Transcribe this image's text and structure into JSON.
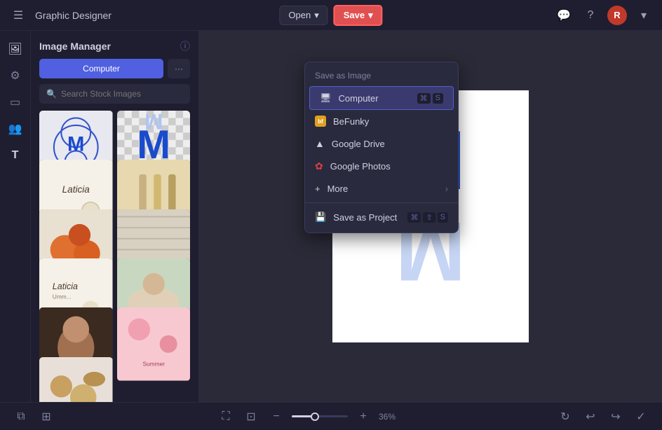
{
  "app": {
    "title": "Graphic Designer",
    "menu_icon": "☰"
  },
  "header": {
    "open_label": "Open",
    "open_chevron": "▾",
    "save_label": "Save",
    "save_chevron": "▾",
    "chat_icon": "💬",
    "help_icon": "?",
    "avatar_label": "R",
    "chevron_icon": "▾"
  },
  "sidebar_icons": [
    {
      "name": "image-icon",
      "symbol": "🖼"
    },
    {
      "name": "sliders-icon",
      "symbol": "⚙"
    },
    {
      "name": "layers-icon",
      "symbol": "▭"
    },
    {
      "name": "people-icon",
      "symbol": "👥"
    },
    {
      "name": "text-icon",
      "symbol": "T"
    }
  ],
  "image_panel": {
    "title": "Image Manager",
    "info_icon": "ⓘ",
    "computer_button": "Computer",
    "more_button": "···",
    "search_placeholder": "Search Stock Images"
  },
  "dropdown": {
    "header": "Save as Image",
    "items": [
      {
        "id": "computer",
        "icon": "🖥",
        "label": "Computer",
        "shortcut": [
          "⌘",
          "S"
        ],
        "highlighted": true
      },
      {
        "id": "befunky",
        "icon": "bf",
        "label": "BeFunky",
        "shortcut": [],
        "highlighted": false
      },
      {
        "id": "google-drive",
        "icon": "▲",
        "label": "Google Drive",
        "shortcut": [],
        "highlighted": false
      },
      {
        "id": "google-photos",
        "icon": "★",
        "label": "Google Photos",
        "shortcut": [],
        "highlighted": false
      }
    ],
    "more_label": "More",
    "more_chevron": "›",
    "divider": true,
    "save_project_label": "Save as Project",
    "save_project_shortcut": [
      "⌘",
      "⇧",
      "S"
    ]
  },
  "canvas": {
    "letter_top": "M",
    "letter_bottom": "M"
  },
  "bottom_toolbar": {
    "layers_icon": "⧉",
    "grid_icon": "⊞",
    "expand_icon": "⛶",
    "crop_icon": "⊡",
    "zoom_out_icon": "−",
    "zoom_in_icon": "+",
    "zoom_percent": "36%",
    "undo_icon": "↩",
    "redo_icon": "↪",
    "rotate_icon": "↻"
  }
}
